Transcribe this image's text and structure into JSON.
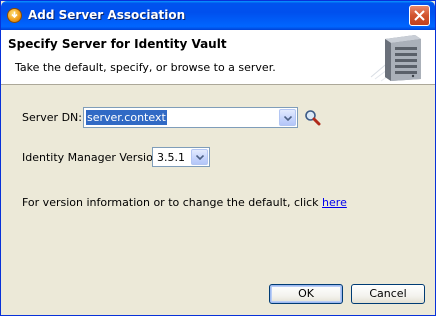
{
  "window": {
    "title": "Add Server Association",
    "icons": {
      "app": "novell-app-icon",
      "close": "close-icon"
    }
  },
  "header": {
    "title": "Specify Server for Identity Vault",
    "description": "Take the default, specify, or browse to a server.",
    "art": "server-tower-graphic"
  },
  "form": {
    "server_dn_label": "Server DN:",
    "server_dn_value": "server.context",
    "version_label": "Identity Manager Version:",
    "version_value": "3.5.1",
    "info_text": "For version information or to change the default, click ",
    "info_link": "here"
  },
  "buttons": {
    "ok": "OK",
    "cancel": "Cancel"
  },
  "colors": {
    "titlebar": "#0054e3",
    "dialog_bg": "#ece9d8",
    "selection": "#316ac5",
    "link": "#0000ee"
  }
}
